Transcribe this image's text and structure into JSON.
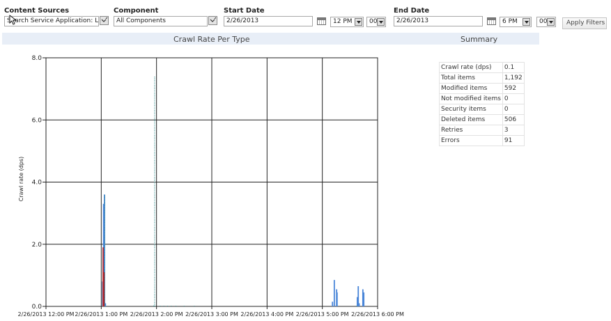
{
  "filters": {
    "content_sources": {
      "label": "Content Sources",
      "value": "Search Service Application: Local"
    },
    "component": {
      "label": "Component",
      "value": "All Components"
    },
    "start_date": {
      "label": "Start Date",
      "date": "2/26/2013",
      "hour": "12 PM",
      "minute": "00"
    },
    "end_date": {
      "label": "End Date",
      "date": "2/26/2013",
      "hour": "6 PM",
      "minute": "00"
    },
    "apply_label": "Apply Filters"
  },
  "chart_title": "Crawl Rate Per Type",
  "summary": {
    "title": "Summary",
    "rows": [
      {
        "label": "Crawl rate (dps)",
        "value": "0.1"
      },
      {
        "label": "Total items",
        "value": "1,192"
      },
      {
        "label": "Modified items",
        "value": "592"
      },
      {
        "label": "Not modified items",
        "value": "0"
      },
      {
        "label": "Security items",
        "value": "0"
      },
      {
        "label": "Deleted items",
        "value": "506"
      },
      {
        "label": "Retries",
        "value": "3"
      },
      {
        "label": "Errors",
        "value": "91"
      }
    ]
  },
  "chart_data": {
    "type": "bar",
    "ylabel": "Crawl rate (dps)",
    "ylim": [
      0,
      8
    ],
    "yticks": [
      "0.0",
      "2.0",
      "4.0",
      "6.0",
      "8.0"
    ],
    "xlim": [
      0,
      360
    ],
    "xticks": [
      {
        "t": 0,
        "label": "2/26/2013 12:00 PM"
      },
      {
        "t": 60,
        "label": "2/26/2013 1:00 PM"
      },
      {
        "t": 120,
        "label": "2/26/2013 2:00 PM"
      },
      {
        "t": 180,
        "label": "2/26/2013 3:00 PM"
      },
      {
        "t": 240,
        "label": "2/26/2013 4:00 PM"
      },
      {
        "t": 300,
        "label": "2/26/2013 5:00 PM"
      },
      {
        "t": 360,
        "label": "2/26/2013 6:00 PM"
      }
    ],
    "grid": true,
    "colors": {
      "blue": "#4a86d8",
      "red": "#b0282e",
      "teal": "#2a8a8a"
    },
    "series": [
      {
        "color": "blue",
        "style": "bar",
        "points": [
          {
            "t": 61.5,
            "v": 0.8
          },
          {
            "t": 62.5,
            "v": 3.3
          },
          {
            "t": 63,
            "v": 2.9
          },
          {
            "t": 63.5,
            "v": 3.6
          },
          {
            "t": 64.5,
            "v": 0.1
          },
          {
            "t": 311,
            "v": 0.15
          },
          {
            "t": 313,
            "v": 0.85
          },
          {
            "t": 315.5,
            "v": 0.55
          },
          {
            "t": 316,
            "v": 0.45
          },
          {
            "t": 338,
            "v": 0.3
          },
          {
            "t": 339,
            "v": 0.65
          },
          {
            "t": 340,
            "v": 0.1
          },
          {
            "t": 344,
            "v": 0.55
          },
          {
            "t": 345,
            "v": 0.45
          }
        ]
      },
      {
        "color": "red",
        "style": "bar",
        "points": [
          {
            "t": 62,
            "v": 1.9
          },
          {
            "t": 63,
            "v": 1.1
          }
        ]
      },
      {
        "color": "teal",
        "style": "dotted",
        "points": [
          {
            "t": 63.8,
            "v": 3.6
          },
          {
            "t": 118,
            "v": 7.4
          },
          {
            "t": 117,
            "v": 0.03
          },
          {
            "t": 124,
            "v": 0.02
          },
          {
            "t": 128,
            "v": 0.02
          },
          {
            "t": 132,
            "v": 0.02
          },
          {
            "t": 136,
            "v": 0.02
          },
          {
            "t": 141,
            "v": 0.02
          },
          {
            "t": 150,
            "v": 0.02
          },
          {
            "t": 161,
            "v": 0.02
          },
          {
            "t": 337,
            "v": 0.02
          }
        ]
      }
    ]
  }
}
